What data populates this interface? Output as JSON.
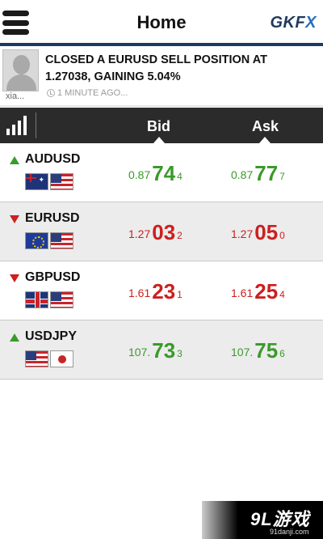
{
  "header": {
    "title": "Home",
    "brand": "GKFX",
    "menu_icon": "hamburger-menu-icon"
  },
  "notification": {
    "user": "xia...",
    "message": "CLOSED A EURUSD SELL POSITION AT 1.27038, GAINING 5.04%",
    "time": "1 MINUTE AGO..."
  },
  "columns": {
    "bid": "Bid",
    "ask": "Ask"
  },
  "colors": {
    "up": "#3a9a2a",
    "down": "#cc1f1f",
    "header_bar": "#2b2b2b",
    "brand": "#1f3a5f"
  },
  "quotes": [
    {
      "symbol": "AUDUSD",
      "direction": "up",
      "flags": [
        "au",
        "us"
      ],
      "bid": {
        "prefix": "0.87",
        "big": "74",
        "pip": "4"
      },
      "ask": {
        "prefix": "0.87",
        "big": "77",
        "pip": "7"
      }
    },
    {
      "symbol": "EURUSD",
      "direction": "down",
      "flags": [
        "eu",
        "us"
      ],
      "bid": {
        "prefix": "1.27",
        "big": "03",
        "pip": "2"
      },
      "ask": {
        "prefix": "1.27",
        "big": "05",
        "pip": "0"
      }
    },
    {
      "symbol": "GBPUSD",
      "direction": "down",
      "flags": [
        "gb",
        "us"
      ],
      "bid": {
        "prefix": "1.61",
        "big": "23",
        "pip": "1"
      },
      "ask": {
        "prefix": "1.61",
        "big": "25",
        "pip": "4"
      }
    },
    {
      "symbol": "USDJPY",
      "direction": "up",
      "flags": [
        "us",
        "jp"
      ],
      "bid": {
        "prefix": "107.",
        "big": "73",
        "pip": "3"
      },
      "ask": {
        "prefix": "107.",
        "big": "75",
        "pip": "6"
      }
    }
  ],
  "watermark": {
    "logo": "9L游戏",
    "url": "91danji.com"
  }
}
